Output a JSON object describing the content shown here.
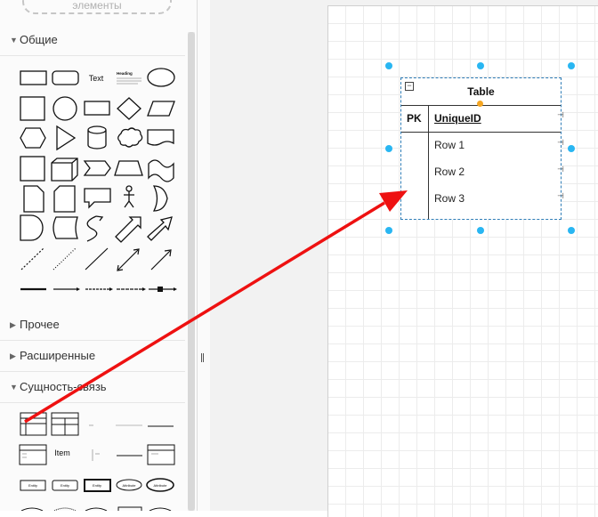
{
  "sidebar": {
    "search_text": "элементы",
    "sections": [
      {
        "label": "Общие",
        "expanded": true
      },
      {
        "label": "Прочее",
        "expanded": false
      },
      {
        "label": "Расширенные",
        "expanded": false
      },
      {
        "label": "Сущность-связь",
        "expanded": true
      }
    ],
    "general_shape_labels": {
      "text": "Text",
      "heading": "Heading"
    },
    "er_shape_labels": {
      "item": "Item",
      "entity": "Entity",
      "attribute": "Attribute"
    }
  },
  "diagram": {
    "table_title": "Table",
    "pk_label": "PK",
    "pk_field": "UniqueID",
    "rows": [
      "Row 1",
      "Row 2",
      "Row 3"
    ],
    "collapse_symbol": "−"
  },
  "colors": {
    "annotation_arrow": "#ee1111",
    "selection_handle": "#29b6f2",
    "hover_handle": "#f5a623"
  },
  "icons": {
    "section_expanded": "triangle-down",
    "section_collapsed": "triangle-right"
  }
}
